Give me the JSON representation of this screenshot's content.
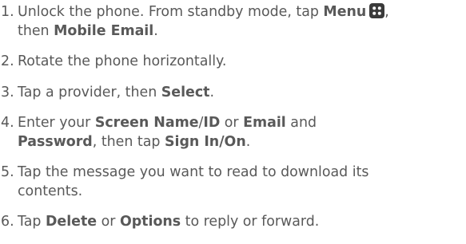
{
  "steps": [
    {
      "number": "1.",
      "line1_a": "Unlock the phone. From standby mode, tap ",
      "line1_b": "Menu",
      "line1_c": ",",
      "icon": "menu-grid-icon",
      "line2_a": "then ",
      "line2_b": "Mobile Email",
      "line2_c": "."
    },
    {
      "number": "2.",
      "text": "Rotate the phone horizontally."
    },
    {
      "number": "3.",
      "a": "Tap a provider, then ",
      "b": "Select",
      "c": "."
    },
    {
      "number": "4.",
      "line1_a": "Enter your ",
      "line1_b": "Screen Name",
      "line1_c": "/",
      "line1_d": "ID",
      "line1_e": " or ",
      "line1_f": "Email",
      "line1_g": " and",
      "line2_a": "Password",
      "line2_b": ", then tap ",
      "line2_c": "Sign In/On",
      "line2_d": "."
    },
    {
      "number": "5.",
      "line1": "Tap the message you want to read to download its",
      "line2": "contents."
    },
    {
      "number": "6.",
      "a": "Tap ",
      "b": "Delete",
      "c": " or ",
      "d": "Options",
      "e": " to reply or forward."
    }
  ],
  "colors": {
    "text": "#595959",
    "icon_bg": "#3a3a3a"
  }
}
